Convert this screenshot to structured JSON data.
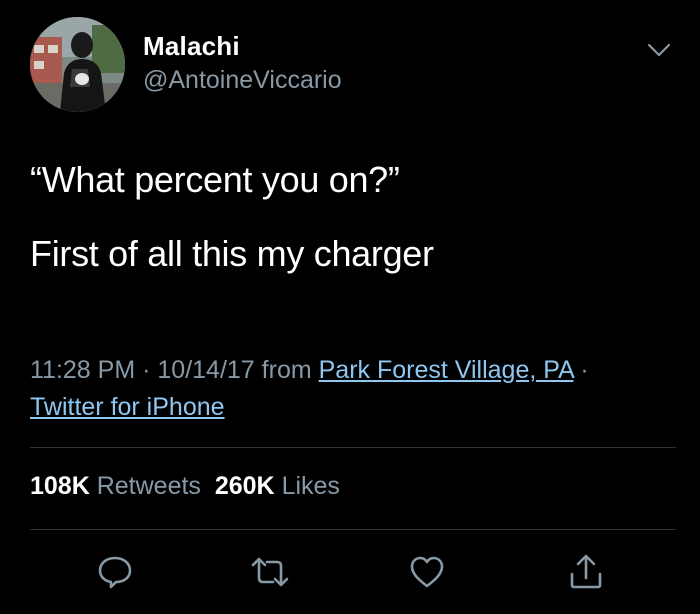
{
  "author": {
    "display_name": "Malachi",
    "handle": "@AntoineViccario"
  },
  "tweet": {
    "line1": "“What percent you on?”",
    "line2": "First of all this my charger"
  },
  "meta": {
    "time": "11:28 PM",
    "date": "10/14/17",
    "from_label": "from",
    "location": "Park Forest Village, PA",
    "separator": "·",
    "client": "Twitter for iPhone"
  },
  "stats": {
    "retweets_count": "108K",
    "retweets_label": "Retweets",
    "likes_count": "260K",
    "likes_label": "Likes"
  },
  "icons": {
    "options": "chevron-down-icon",
    "reply": "reply-icon",
    "retweet": "retweet-icon",
    "like": "heart-icon",
    "share": "share-icon"
  },
  "colors": {
    "background": "#000000",
    "primary_text": "#ffffff",
    "secondary_text": "#8899a6",
    "link": "#8ec7f2",
    "divider": "#2f3336"
  }
}
